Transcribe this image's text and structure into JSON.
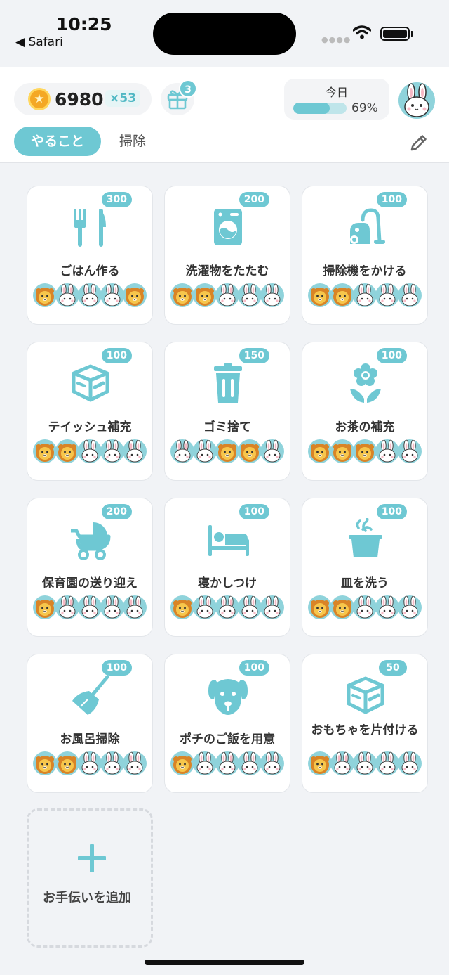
{
  "status_bar": {
    "time": "10:25",
    "back_label": "◀ Safari"
  },
  "header": {
    "coins": "6980",
    "multiplier": "×53",
    "gift_count": "3",
    "today_label": "今日",
    "today_progress": 0.69,
    "today_percent": "69%",
    "tabs": [
      {
        "label": "やること",
        "active": true
      },
      {
        "label": "掃除",
        "active": false
      }
    ]
  },
  "tasks": [
    {
      "title": "ごはん作る",
      "points": "300",
      "icon": "fork-knife-icon",
      "faces": [
        "lion",
        "rabbit",
        "rabbit",
        "rabbit",
        "lion"
      ]
    },
    {
      "title": "洗濯物をたたむ",
      "points": "200",
      "icon": "washing-machine-icon",
      "faces": [
        "lion",
        "lion",
        "rabbit",
        "rabbit",
        "rabbit"
      ]
    },
    {
      "title": "掃除機をかける",
      "points": "100",
      "icon": "vacuum-cleaner-icon",
      "faces": [
        "lion",
        "lion",
        "rabbit",
        "rabbit",
        "rabbit"
      ]
    },
    {
      "title": "テイッシュ補充",
      "points": "100",
      "icon": "box-icon",
      "faces": [
        "lion",
        "lion",
        "rabbit",
        "rabbit",
        "rabbit"
      ]
    },
    {
      "title": "ゴミ捨て",
      "points": "150",
      "icon": "trash-can-icon",
      "faces": [
        "rabbit",
        "rabbit",
        "lion",
        "lion",
        "rabbit"
      ]
    },
    {
      "title": "お茶の補充",
      "points": "100",
      "icon": "flower-icon",
      "faces": [
        "lion",
        "lion",
        "lion",
        "rabbit",
        "rabbit"
      ]
    },
    {
      "title": "保育園の送り迎え",
      "points": "200",
      "icon": "stroller-icon",
      "faces": [
        "lion",
        "rabbit",
        "rabbit",
        "rabbit",
        "rabbit"
      ]
    },
    {
      "title": "寝かしつけ",
      "points": "100",
      "icon": "bed-icon",
      "faces": [
        "lion",
        "rabbit",
        "rabbit",
        "rabbit",
        "rabbit"
      ]
    },
    {
      "title": "皿を洗う",
      "points": "100",
      "icon": "pot-icon",
      "faces": [
        "lion",
        "lion",
        "rabbit",
        "rabbit",
        "rabbit"
      ]
    },
    {
      "title": "お風呂掃除",
      "points": "100",
      "icon": "broom-icon",
      "faces": [
        "lion",
        "lion",
        "rabbit",
        "rabbit",
        "rabbit"
      ]
    },
    {
      "title": "ポチのご飯を用意",
      "points": "100",
      "icon": "dog-icon",
      "faces": [
        "lion",
        "rabbit",
        "rabbit",
        "rabbit",
        "rabbit"
      ]
    },
    {
      "title": "おもちゃを片付ける",
      "points": "50",
      "icon": "box-icon",
      "faces": [
        "lion",
        "rabbit",
        "rabbit",
        "rabbit",
        "rabbit"
      ]
    }
  ],
  "add_task_label": "お手伝いを追加",
  "colors": {
    "accent": "#6ec8d3",
    "background": "#f1f3f6",
    "face_bg": "#8fd3db",
    "coin": "#f4a824"
  }
}
